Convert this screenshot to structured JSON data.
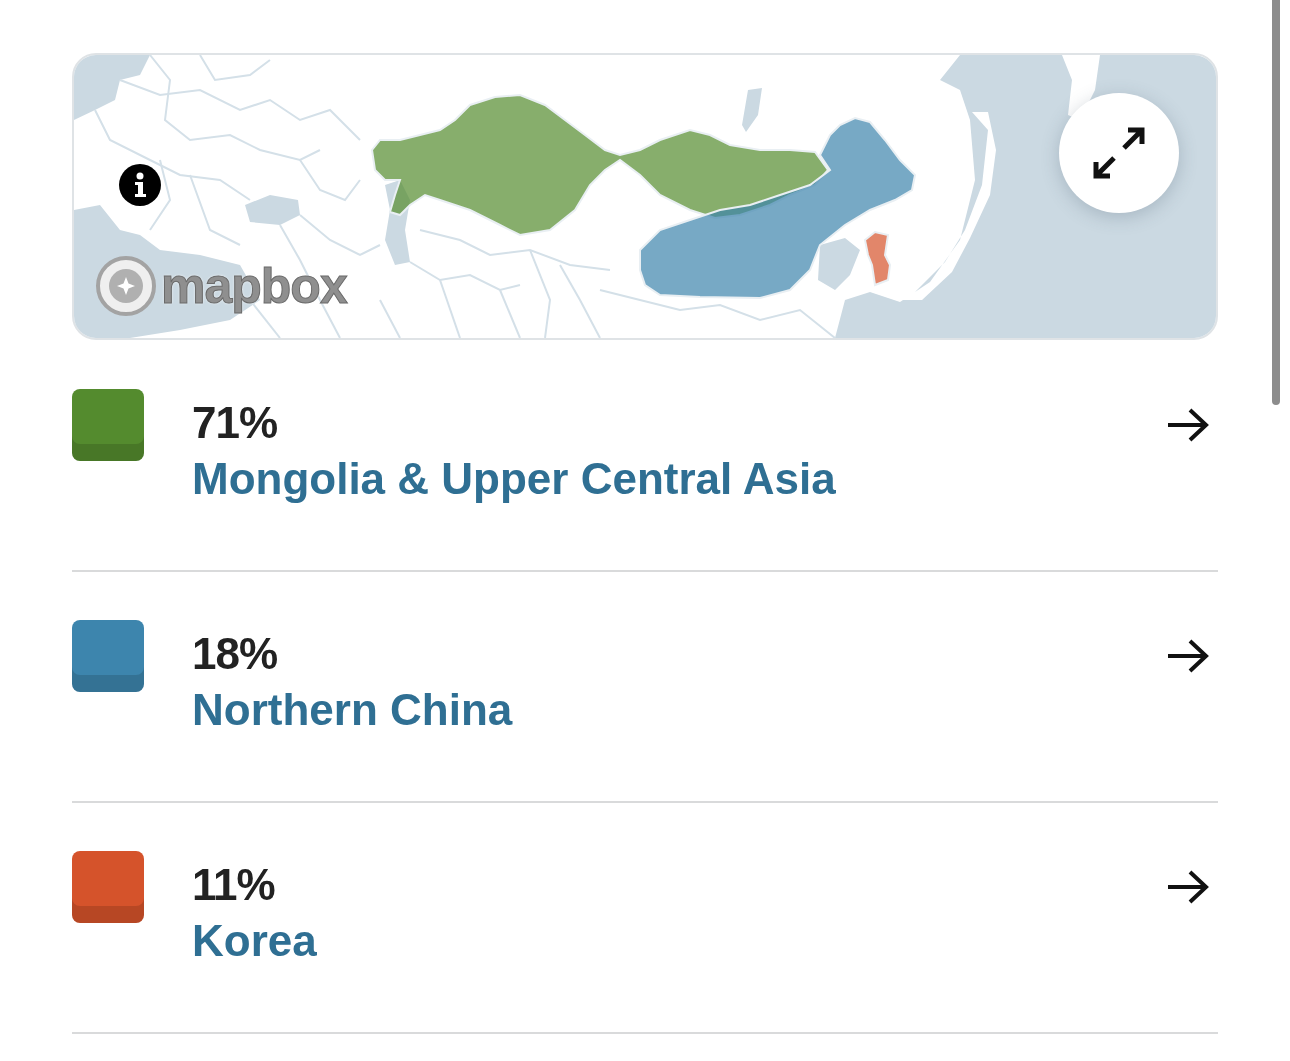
{
  "map": {
    "attribution": "mapbox"
  },
  "regions": [
    {
      "percentage": "71%",
      "name": "Mongolia & Upper Central Asia",
      "color": "#548b2e"
    },
    {
      "percentage": "18%",
      "name": "Northern China",
      "color": "#3d85ad"
    },
    {
      "percentage": "11%",
      "name": "Korea",
      "color": "#d5532b"
    }
  ]
}
